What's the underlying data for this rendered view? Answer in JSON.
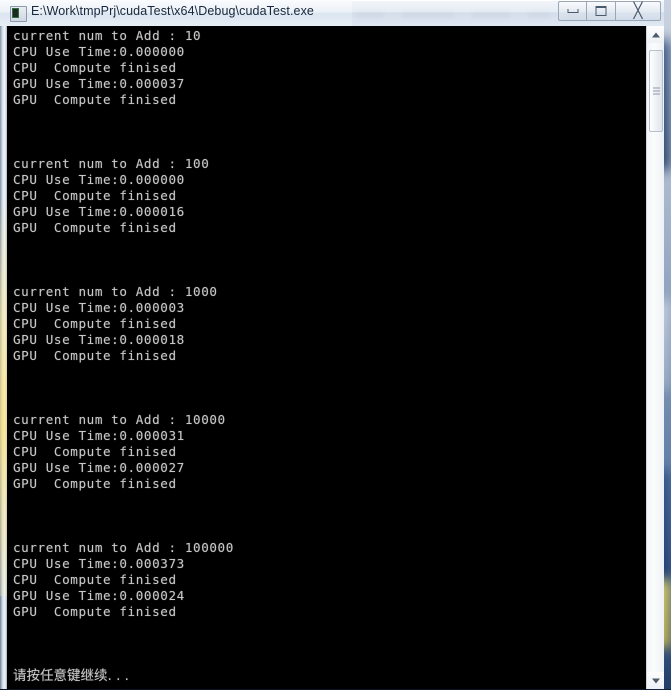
{
  "window": {
    "title": "E:\\Work\\tmpPrj\\cudaTest\\x64\\Debug\\cudaTest.exe",
    "icon": "console-window-icon",
    "controls": {
      "minimize_label": "Minimize",
      "maximize_label": "Maximize",
      "close_label": "╳"
    }
  },
  "background": {
    "blurred_menu_items": [
      "",
      "",
      "",
      "",
      ""
    ]
  },
  "console": {
    "prompt_line": "请按任意键继续. . .",
    "blocks": [
      {
        "header": "current num to Add : 10",
        "cpu_time": "CPU Use Time:0.000000",
        "cpu_done": "CPU  Compute finised",
        "gpu_time": "GPU Use Time:0.000037",
        "gpu_done": "GPU  Compute finised"
      },
      {
        "header": "current num to Add : 100",
        "cpu_time": "CPU Use Time:0.000000",
        "cpu_done": "CPU  Compute finised",
        "gpu_time": "GPU Use Time:0.000016",
        "gpu_done": "GPU  Compute finised"
      },
      {
        "header": "current num to Add : 1000",
        "cpu_time": "CPU Use Time:0.000003",
        "cpu_done": "CPU  Compute finised",
        "gpu_time": "GPU Use Time:0.000018",
        "gpu_done": "GPU  Compute finised"
      },
      {
        "header": "current num to Add : 10000",
        "cpu_time": "CPU Use Time:0.000031",
        "cpu_done": "CPU  Compute finised",
        "gpu_time": "GPU Use Time:0.000027",
        "gpu_done": "GPU  Compute finised"
      },
      {
        "header": "current num to Add : 100000",
        "cpu_time": "CPU Use Time:0.000373",
        "cpu_done": "CPU  Compute finised",
        "gpu_time": "GPU Use Time:0.000024",
        "gpu_done": "GPU  Compute finised"
      }
    ]
  },
  "scrollbar": {
    "up_arrow": "scroll-up-arrow",
    "down_arrow": "scroll-down-arrow"
  },
  "colors": {
    "console_background": "#000000",
    "console_text": "#c8c8c8",
    "titlebar_text": "#17273c"
  }
}
